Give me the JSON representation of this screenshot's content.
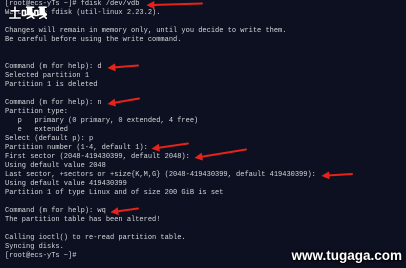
{
  "terminal": {
    "lines": [
      "[root@ecs-yTs ~]# fdisk /dev/vdb",
      "Welcome to fdisk (util-linux 2.23.2).",
      "Changes will remain in memory only, until you decide to write them.",
      "Be careful before using the write command.",
      "Command (m for help): d",
      "Selected partition 1",
      "Partition 1 is deleted",
      "Command (m for help): n",
      "Partition type:",
      "   p   primary (0 primary, 0 extended, 4 free)",
      "   e   extended",
      "Select (default p): p",
      "Partition number (1-4, default 1):",
      "First sector (2048-419430399, default 2048):",
      "Using default value 2048",
      "Last sector, +sectors or +size{K,M,G} (2048-419430399, default 419430399):",
      "Using default value 419430399",
      "Partition 1 of type Linux and of size 200 GiB is set",
      "Command (m for help): wq",
      "The partition table has been altered!",
      "Calling ioctl() to re-read partition table.",
      "Syncing disks.",
      "[root@ecs-yTs ~]#"
    ]
  },
  "watermarks": {
    "top_left": "土嘎嘎",
    "bottom_right": "www.tugaga.com"
  },
  "colors": {
    "background": "#0d1021",
    "text": "#d6d8dc",
    "annotation_arrow": "#e5231b",
    "watermark": "#ffffff"
  }
}
